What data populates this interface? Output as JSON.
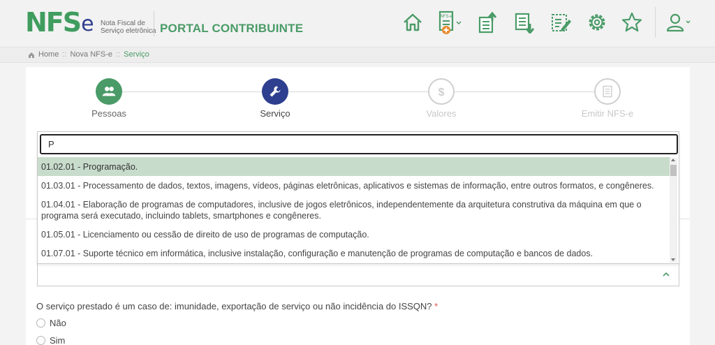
{
  "header": {
    "logo_main": "NFS",
    "logo_e": "e",
    "logo_subtitle_line1": "Nota Fiscal de",
    "logo_subtitle_line2": "Serviço eletrônica",
    "portal_title": "PORTAL CONTRIBUINTE",
    "nfse_icon_badge": "NFS-e",
    "icons": [
      "home-icon",
      "new-nfse-icon",
      "upload-document-icon",
      "download-document-icon",
      "edit-document-icon",
      "settings-gear-icon",
      "star-icon",
      "user-icon"
    ],
    "colors": {
      "brand_green": "#4a9b67",
      "brand_blue": "#2f3f8f"
    }
  },
  "breadcrumb": {
    "items": [
      "Home",
      "Nova NFS-e",
      "Serviço"
    ],
    "separator": "::"
  },
  "stepper": {
    "steps": [
      {
        "label": "Pessoas",
        "state": "done",
        "icon": "people-icon"
      },
      {
        "label": "Serviço",
        "state": "active",
        "icon": "wrench-icon"
      },
      {
        "label": "Valores",
        "state": "todo",
        "icon": "dollar-icon"
      },
      {
        "label": "Emitir NFS-e",
        "state": "todo",
        "icon": "document-icon"
      }
    ]
  },
  "service_dropdown": {
    "search_value": "P",
    "selected_index": 0,
    "options": [
      "01.02.01 - Programação.",
      "01.03.01 - Processamento de dados, textos, imagens, vídeos, páginas eletrônicas, aplicativos e sistemas de informação, entre outros formatos, e congêneres.",
      "01.04.01 - Elaboração de programas de computadores, inclusive de jogos eletrônicos, independentemente da arquitetura construtiva da máquina em que o programa será executado, incluindo tablets, smartphones e congêneres.",
      "01.05.01 - Licenciamento ou cessão de direito de uso de programas de computação.",
      "01.07.01 - Suporte técnico em informática, inclusive instalação, configuração e manutenção de programas de computação e bancos de dados."
    ],
    "select_value": ""
  },
  "issqn_question": {
    "text": "O serviço prestado é um caso de: imunidade, exportação de serviço ou não incidência do ISSQN?",
    "required_mark": "*",
    "options": [
      "Não",
      "Sim"
    ]
  }
}
